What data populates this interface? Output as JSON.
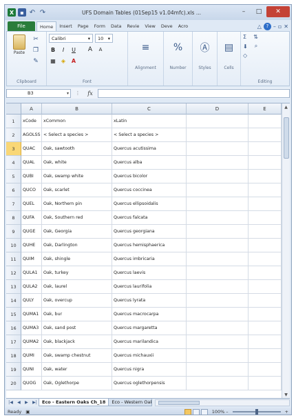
{
  "window": {
    "title": "UFS Domain Tables (01Sep15 v1.04mfc).xls  ...",
    "minimize": "–",
    "maximize": "□",
    "close": "✕"
  },
  "ribbon_tabs": [
    "File",
    "Home",
    "Insert",
    "Page",
    "Form",
    "Data",
    "Revie",
    "View",
    "Deve",
    "Acro"
  ],
  "active_tab": "Home",
  "ribbon": {
    "clipboard": {
      "paste": "Paste",
      "label": "Clipboard"
    },
    "font": {
      "name": "Calibri",
      "size": "10",
      "label": "Font",
      "bold": "B",
      "italic": "I",
      "underline": "U",
      "grow": "A",
      "shrink": "A"
    },
    "alignment": {
      "label": "Alignment"
    },
    "number": {
      "label": "Number"
    },
    "styles": {
      "label": "Styles"
    },
    "cells": {
      "label": "Cells"
    },
    "editing": {
      "label": "Editing"
    }
  },
  "formula_bar": {
    "name_box": "B3",
    "fx": "fx",
    "value": ""
  },
  "columns": [
    "A",
    "B",
    "C",
    "D",
    "E"
  ],
  "rows": [
    {
      "n": "1",
      "a": "xCode",
      "b": "xCommon",
      "c": "xLatin"
    },
    {
      "n": "2",
      "a": "AGOLSS",
      "b": "< Select a species >",
      "c": "< Select a species >"
    },
    {
      "n": "3",
      "a": "QUAC",
      "b": "Oak, sawtooth",
      "c": "Quercus acutissima"
    },
    {
      "n": "4",
      "a": "QUAL",
      "b": "Oak, white",
      "c": "Quercus alba"
    },
    {
      "n": "5",
      "a": "QUBI",
      "b": "Oak, swamp white",
      "c": "Quercus bicolor"
    },
    {
      "n": "6",
      "a": "QUCO",
      "b": "Oak, scarlet",
      "c": "Quercus coccinea"
    },
    {
      "n": "7",
      "a": "QUEL",
      "b": "Oak, Northern pin",
      "c": "Quercus ellipsoidalis"
    },
    {
      "n": "8",
      "a": "QUFA",
      "b": "Oak, Southern red",
      "c": "Quercus falcata"
    },
    {
      "n": "9",
      "a": "QUGE",
      "b": "Oak, Georgia",
      "c": "Quercus georgiana"
    },
    {
      "n": "10",
      "a": "QUHE",
      "b": "Oak, Darlington",
      "c": "Quercus hemisphaerica"
    },
    {
      "n": "11",
      "a": "QUIM",
      "b": "Oak, shingle",
      "c": "Quercus imbricaria"
    },
    {
      "n": "12",
      "a": "QULA1",
      "b": "Oak, turkey",
      "c": "Quercus laevis"
    },
    {
      "n": "13",
      "a": "QULA2",
      "b": "Oak, laurel",
      "c": "Quercus laurifolia"
    },
    {
      "n": "14",
      "a": "QULY",
      "b": "Oak, overcup",
      "c": "Quercus lyrata"
    },
    {
      "n": "15",
      "a": "QUMA1",
      "b": "Oak, bur",
      "c": "Quercus macrocarpa"
    },
    {
      "n": "16",
      "a": "QUMA3",
      "b": "Oak, sand post",
      "c": "Quercus margaretta"
    },
    {
      "n": "17",
      "a": "QUMA2",
      "b": "Oak, blackjack",
      "c": "Quercus marilandica"
    },
    {
      "n": "18",
      "a": "QUMI",
      "b": "Oak, swamp chestnut",
      "c": "Quercus michauxii"
    },
    {
      "n": "19",
      "a": "QUNI",
      "b": "Oak, water",
      "c": "Quercus nigra"
    },
    {
      "n": "20",
      "a": "QUOG",
      "b": "Oak, Oglethorpe",
      "c": "Quercus oglethorpensis"
    }
  ],
  "selected_row": "3",
  "sheets": {
    "active": "Eco - Eastern Oaks Ch_18",
    "next": "Eco - Western Oaks Ch"
  },
  "status": {
    "ready": "Ready",
    "zoom": "100%"
  },
  "colors": {
    "file_tab": "#2a7d3b",
    "selection": "#f9d776"
  }
}
